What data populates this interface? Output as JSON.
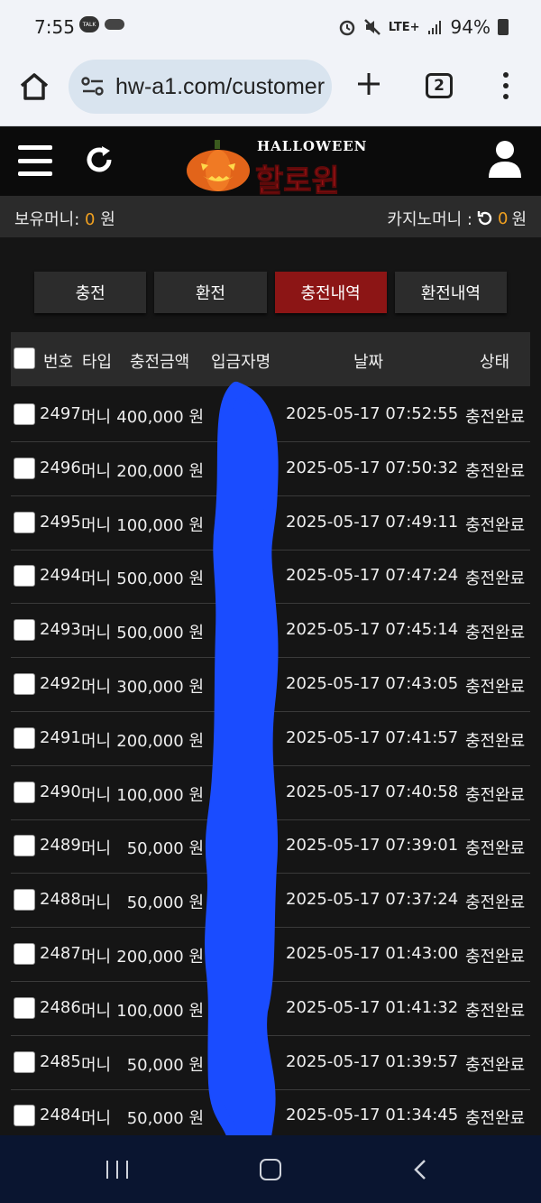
{
  "status_bar": {
    "time": "7:55",
    "network": "LTE+",
    "battery": "94%",
    "icons": [
      "kakaotalk-icon",
      "cloud-icon",
      "alarm-icon",
      "mute-icon",
      "signal-icon",
      "battery-icon"
    ]
  },
  "browser": {
    "url": "hw-a1.com/customer",
    "tab_count": "2"
  },
  "header": {
    "logo_title": "HALLOWEEN",
    "logo_korean": "할로윈"
  },
  "money": {
    "held_label": "보유머니: ",
    "held_amount": "0",
    "held_unit": " 원",
    "casino_label": "카지노머니 : ",
    "casino_amount": "0",
    "casino_unit": " 원"
  },
  "tabs": [
    {
      "label": "충전",
      "active": false
    },
    {
      "label": "환전",
      "active": false
    },
    {
      "label": "충전내역",
      "active": true
    },
    {
      "label": "환전내역",
      "active": false
    }
  ],
  "table": {
    "headers": {
      "number": "번호",
      "type": "타입",
      "amount": "충전금액",
      "depositor": "입금자명",
      "date": "날짜",
      "status": "상태"
    },
    "rows": [
      {
        "number": "2497",
        "type": "머니",
        "amount": "400,000 원",
        "date": "2025-05-17 07:52:55",
        "status": "충전완료"
      },
      {
        "number": "2496",
        "type": "머니",
        "amount": "200,000 원",
        "date": "2025-05-17 07:50:32",
        "status": "충전완료"
      },
      {
        "number": "2495",
        "type": "머니",
        "amount": "100,000 원",
        "date": "2025-05-17 07:49:11",
        "status": "충전완료"
      },
      {
        "number": "2494",
        "type": "머니",
        "amount": "500,000 원",
        "date": "2025-05-17 07:47:24",
        "status": "충전완료"
      },
      {
        "number": "2493",
        "type": "머니",
        "amount": "500,000 원",
        "date": "2025-05-17 07:45:14",
        "status": "충전완료"
      },
      {
        "number": "2492",
        "type": "머니",
        "amount": "300,000 원",
        "date": "2025-05-17 07:43:05",
        "status": "충전완료"
      },
      {
        "number": "2491",
        "type": "머니",
        "amount": "200,000 원",
        "date": "2025-05-17 07:41:57",
        "status": "충전완료"
      },
      {
        "number": "2490",
        "type": "머니",
        "amount": "100,000 원",
        "date": "2025-05-17 07:40:58",
        "status": "충전완료"
      },
      {
        "number": "2489",
        "type": "머니",
        "amount": "50,000 원",
        "date": "2025-05-17 07:39:01",
        "status": "충전완료"
      },
      {
        "number": "2488",
        "type": "머니",
        "amount": "50,000 원",
        "date": "2025-05-17 07:37:24",
        "status": "충전완료"
      },
      {
        "number": "2487",
        "type": "머니",
        "amount": "200,000 원",
        "date": "2025-05-17 01:43:00",
        "status": "충전완료"
      },
      {
        "number": "2486",
        "type": "머니",
        "amount": "100,000 원",
        "date": "2025-05-17 01:41:32",
        "status": "충전완료"
      },
      {
        "number": "2485",
        "type": "머니",
        "amount": "50,000 원",
        "date": "2025-05-17 01:39:57",
        "status": "충전완료"
      },
      {
        "number": "2484",
        "type": "머니",
        "amount": "50,000 원",
        "date": "2025-05-17 01:34:45",
        "status": "충전완료"
      }
    ]
  },
  "colors": {
    "accent_tab": "#8c1515",
    "money_amount": "#f0a020",
    "redaction": "#1a4cff",
    "header_bg": "#0b0b0b"
  }
}
